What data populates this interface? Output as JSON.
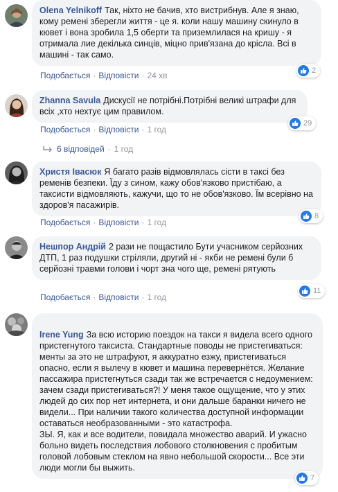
{
  "comments": [
    {
      "author": "Olena Yelnikoff",
      "text": "Так, ніхто не бачив, хто вистрибнув. Але я знаю, кому ремені зберегли життя - це я. коли нашу машину скинуло в кювет і вона зробила 1,5 оберти та приземлилася на кришу - я отримала лие декілька синців, міцно прив'язана до крісла. Всі в машині - так само.",
      "like_label": "Подобається",
      "reply_label": "Відповісти",
      "time": "24 хв",
      "reactions": "2"
    },
    {
      "author": "Zhanna Savula",
      "text": "Дискусії не потрібні.Потрібні великі штрафи для всіх ,хто нехтує цим правилом.",
      "like_label": "Подобається",
      "reply_label": "Відповісти",
      "time": "1 год",
      "reactions": "29",
      "replies_label": "6 відповідей",
      "replies_time": "1 год"
    },
    {
      "author": "Христя Івасюк",
      "text": "Я багато разів відмовлялась сісти в таксі без ременів безпеки. Їду з сином, кажу обов'язково пристібаю, а таксисти відмовляють, кажучи, що то не обов'язково. Їм всерівно на здоров'я пасажирів.",
      "like_label": "Подобається",
      "reply_label": "Відповісти",
      "time": "1 год",
      "reactions": "8"
    },
    {
      "author": "Нешпор Андрій",
      "text": "2 рази не пощастило Бути учасником серйозних ДТП, 1 раз подушки стріляли, другий ні - якби не ремені були б серйозні травми голови і чорт зна чого ще, ремені рятують",
      "like_label": "Подобається",
      "reply_label": "Відповісти",
      "time": "1 год",
      "reactions": "11"
    },
    {
      "author": "Irene Yung",
      "text": "За всю историю поездок на такси я видела всего одного пристегнутого таксиста. Стандартные поводы не пристегиваться: менты за это не штрафуют, я аккуратно езжу, пристегиваться опасно, если я вылечу в кювет и машина перевернётся. Желание пассажира пристегнуться сзади так же встречается с недоумением: зачем сзади пристегиваться?! У меня такое ощущение, что у этих людей до сих пор нет интернета, и они дальше баранки ничего не видели... При наличии такого количества доступной информации оставаться необразованными - это катастрофа.\nЗЫ. Я, как и все водители, повидала множество аварий. И ужасно больно видеть последствия лобового столкновения с пробитым головой лобовым стеклом на явно небольшой скорости... Все эти люди могли бы выжить.",
      "reactions": "7"
    }
  ],
  "colors": {
    "link": "#385898",
    "bubble": "#f2f3f5",
    "like": "#2078f4",
    "meta": "#90949c"
  }
}
